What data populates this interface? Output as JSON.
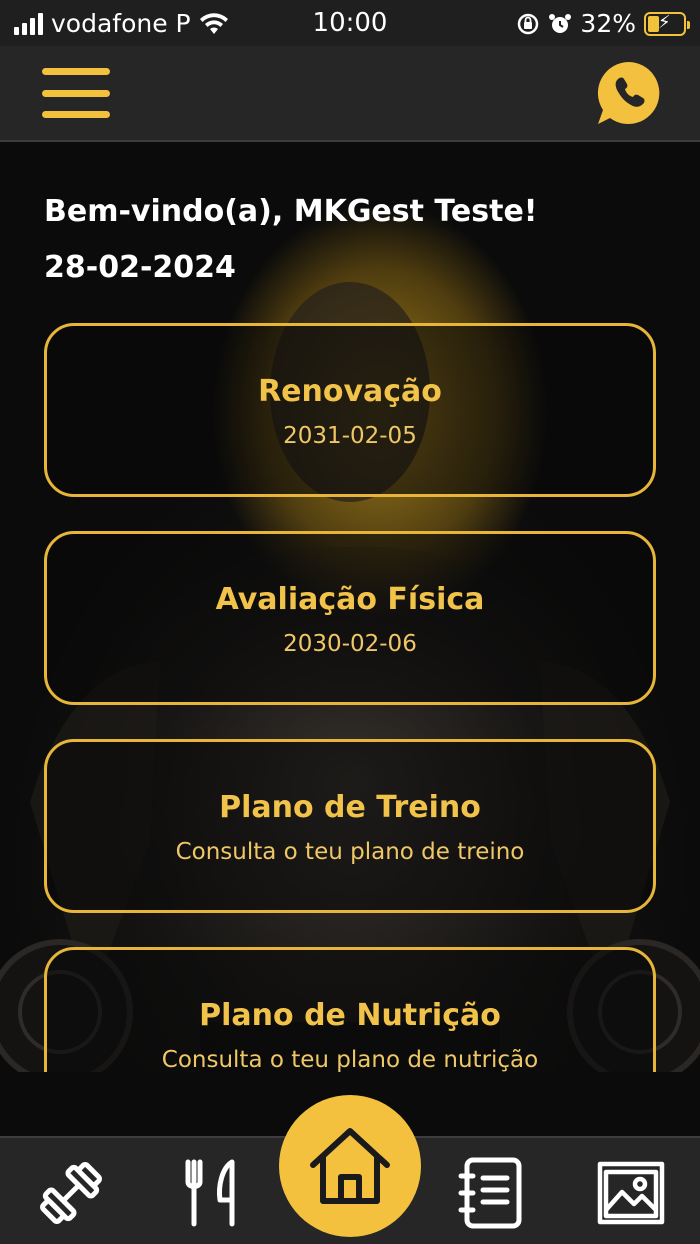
{
  "status_bar": {
    "carrier": "vodafone P",
    "time": "10:00",
    "battery": "32%"
  },
  "header": {
    "menu_icon": "hamburger-icon",
    "contact_icon": "phone-chat-icon"
  },
  "main": {
    "welcome": "Bem-vindo(a), MKGest Teste!",
    "date": "28-02-2024",
    "cards": [
      {
        "title": "Renovação",
        "subtitle": "2031-02-05"
      },
      {
        "title": "Avaliação Física",
        "subtitle": "2030-02-06"
      },
      {
        "title": "Plano de Treino",
        "subtitle": "Consulta o teu plano de treino"
      },
      {
        "title": "Plano de Nutrição",
        "subtitle": "Consulta o teu plano de nutrição"
      }
    ]
  },
  "bottom_nav": {
    "items": [
      "dumbbell-icon",
      "fork-knife-icon",
      "home-icon",
      "notebook-icon",
      "gallery-icon"
    ],
    "accent": "#f3c13e"
  }
}
